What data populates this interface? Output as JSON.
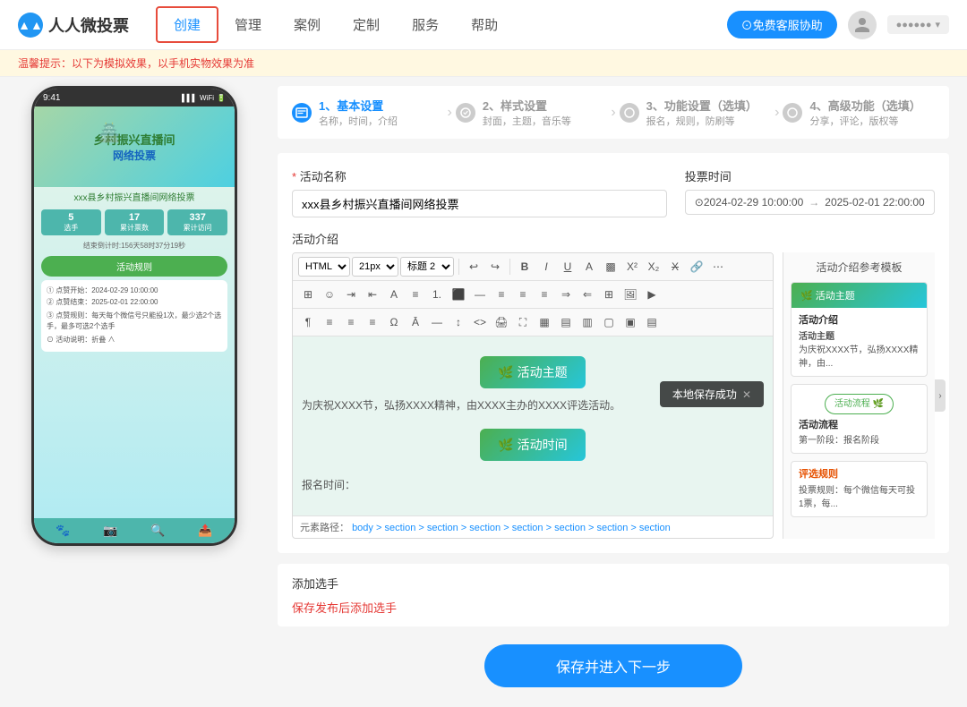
{
  "header": {
    "logo_text": "人人微投票",
    "nav_items": [
      "创建",
      "管理",
      "案例",
      "定制",
      "服务",
      "帮助"
    ],
    "active_nav": "创建",
    "btn_service": "⊙免费客服协助"
  },
  "warm_tip": "温馨提示：以下为模拟效果，以手机实物效果为准",
  "phone": {
    "time": "9:41",
    "title": "xxx县乡村振兴直播间网络投票",
    "banner_title": "乡村振兴直播间",
    "banner_subtitle": "网络投票",
    "stats": [
      {
        "num": "5",
        "label": "选手"
      },
      {
        "num": "17",
        "label": "累计票数"
      },
      {
        "num": "337",
        "label": "累计访问"
      }
    ],
    "countdown": "结束倒计时:156天58时37分19秒",
    "rule_btn": "活动规则",
    "info_items": [
      "① 点赞开始：2024-02-29 10:00:00",
      "② 点赞结束：2025-02-01 22:00:00",
      "③ 点赞规则：每天每个微信号只能投1次，最少选2个选手，最多可选2个选手",
      "⊙ 活动说明：折叠 ∧"
    ]
  },
  "steps": [
    {
      "num": "1",
      "title": "1、基本设置",
      "sub": "名称，时间，介绍",
      "active": true
    },
    {
      "num": "2",
      "title": "2、样式设置",
      "sub": "封面，主题，音乐等",
      "active": false
    },
    {
      "num": "3",
      "title": "3、功能设置（选填）",
      "sub": "报名，规则，防刷等",
      "active": false
    },
    {
      "num": "4",
      "title": "4、高级功能（选填）",
      "sub": "分享，评论，版权等",
      "active": false
    }
  ],
  "form": {
    "activity_name_label": "活动名称",
    "activity_name_required": "*",
    "activity_name_value": "xxx县乡村振兴直播间网络投票",
    "vote_time_label": "投票时间",
    "date_start": "⊙2024-02-29 10:00:00",
    "date_arrow": "→",
    "date_end": "2025-02-01 22:00:00",
    "intro_label": "活动介绍",
    "editor_html": "HTML",
    "editor_font_size": "21px",
    "editor_format": "标题 2",
    "editor_content_text": "为庆祝XXXX节，弘扬XXXX精神，由XXXX主办的XXXX评选活动。",
    "editor_theme_btn": "🌿 活动主题",
    "editor_time_btn": "🌿 活动时间",
    "editor_report_time": "报名时间：",
    "breadcrumb_label": "元素路径：",
    "breadcrumb_items": [
      "body",
      "section",
      "section",
      "section",
      "section",
      "section",
      "section",
      "section"
    ],
    "save_toast": "本地保存成功"
  },
  "template": {
    "title": "活动介绍参考模板",
    "cards": [
      {
        "header": "🌿 活动主题",
        "body_title": "活动介绍",
        "body_sub_title": "活动主题",
        "body_text": "为庆祝XXXX节，弘扬XXXX精神，由...",
        "btn": null
      },
      {
        "header": null,
        "body_title": "活动流程",
        "btn": "活动流程 🌿",
        "body_text": "第一阶段：报名阶段"
      },
      {
        "header": null,
        "body_title": "评选规则",
        "btn": null,
        "body_text": "投票规则：每个微信每天可投1票，每..."
      }
    ]
  },
  "add_player": {
    "title": "添加选手",
    "link_text": "保存发布后添加选手"
  },
  "footer": {
    "save_btn": "保存并进入下一步"
  }
}
